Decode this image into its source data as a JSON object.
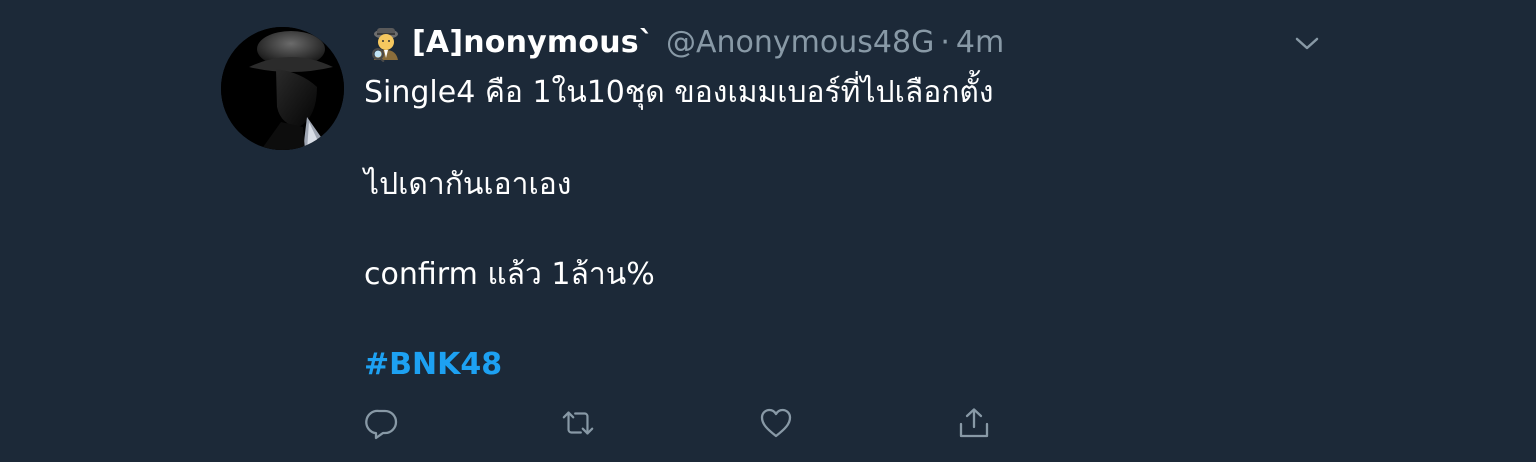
{
  "tweet": {
    "display_name": "[A]nonymous`",
    "handle": "@Anonymous48G",
    "separator": "·",
    "time": "4m",
    "emoji_icon": "detective-icon",
    "avatar_icon": "hat-man-silhouette",
    "lines": [
      "Single4 คือ 1ใน10ชุด ของเมมเบอร์ที่ไปเลือกตั้ง",
      "ไปเดากันเอาเอง",
      "confirm แล้ว 1ล้าน%"
    ],
    "hashtag": "#BNK48"
  },
  "actions": [
    {
      "icon": "reply-icon"
    },
    {
      "icon": "retweet-icon"
    },
    {
      "icon": "like-icon"
    },
    {
      "icon": "share-icon"
    }
  ],
  "colors": {
    "background": "#1c2938",
    "text": "#ffffff",
    "secondary": "#8899a6",
    "accent": "#1da1f2"
  }
}
